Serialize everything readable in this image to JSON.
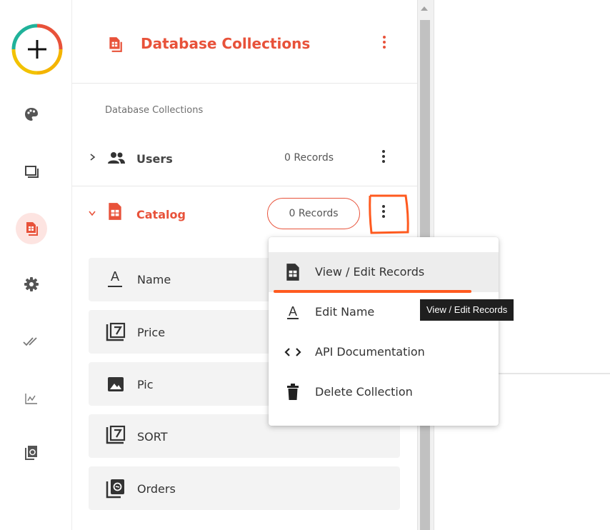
{
  "panel": {
    "title": "Database Collections",
    "section_label": "Database Collections"
  },
  "collections": [
    {
      "name": "Users",
      "records": "0 Records"
    },
    {
      "name": "Catalog",
      "records": "0 Records"
    }
  ],
  "fields": [
    {
      "label": "Name",
      "icon": "text-field-icon"
    },
    {
      "label": "Price",
      "icon": "number-field-icon"
    },
    {
      "label": "Pic",
      "icon": "image-field-icon"
    },
    {
      "label": "SORT",
      "icon": "number-field-icon"
    },
    {
      "label": "Orders",
      "icon": "reference-field-icon"
    }
  ],
  "menu": {
    "items": [
      {
        "label": "View / Edit Records",
        "icon": "table-icon"
      },
      {
        "label": "Edit Name",
        "icon": "text-icon"
      },
      {
        "label": "API Documentation",
        "icon": "code-icon"
      },
      {
        "label": "Delete Collection",
        "icon": "trash-icon"
      }
    ]
  },
  "tooltip": "View / Edit Records",
  "rail": [
    "add-icon",
    "palette-icon",
    "pages-icon",
    "database-icon",
    "gear-icon",
    "checks-icon",
    "analytics-icon",
    "files-icon"
  ],
  "colors": {
    "accent": "#e8523a",
    "annotation": "#ff5a1f",
    "active_bg": "#fde4e1"
  }
}
